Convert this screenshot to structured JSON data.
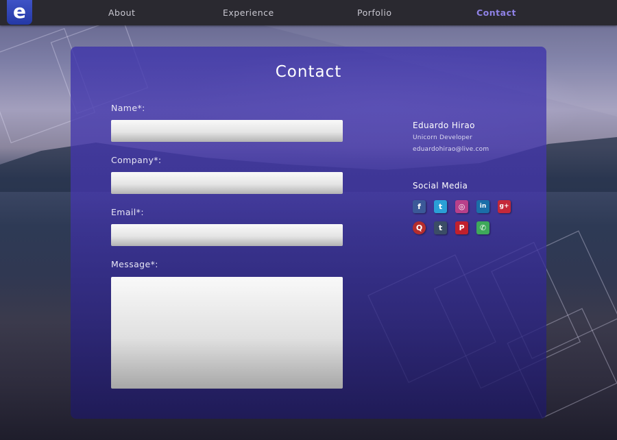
{
  "nav": {
    "logo_letter": "e",
    "items": [
      {
        "label": "About",
        "active": false
      },
      {
        "label": "Experience",
        "active": false
      },
      {
        "label": "Porfolio",
        "active": false
      },
      {
        "label": "Contact",
        "active": true
      }
    ]
  },
  "contact": {
    "title": "Contact",
    "fields": {
      "name": {
        "label": "Name*:",
        "value": "",
        "placeholder": ""
      },
      "company": {
        "label": "Company*:",
        "value": "",
        "placeholder": ""
      },
      "email": {
        "label": "Email*:",
        "value": "",
        "placeholder": ""
      },
      "message": {
        "label": "Message*:",
        "value": "",
        "placeholder": ""
      }
    }
  },
  "profile": {
    "name": "Eduardo Hirao",
    "role": "Unicorn Developer",
    "email": "eduardohirao@live.com"
  },
  "social": {
    "title": "Social Media",
    "icons": [
      {
        "name": "facebook-icon",
        "glyph": "f",
        "color": "#3b5998"
      },
      {
        "name": "twitter-icon",
        "glyph": "t",
        "color": "#2a9fd6"
      },
      {
        "name": "instagram-icon",
        "glyph": "◎",
        "color": "#b8408a"
      },
      {
        "name": "linkedin-icon",
        "glyph": "in",
        "color": "#1b6ea8"
      },
      {
        "name": "google-plus-icon",
        "glyph": "g+",
        "color": "#c4283a"
      },
      {
        "name": "quora-icon",
        "glyph": "Q",
        "color": "#b52d2d"
      },
      {
        "name": "tumblr-icon",
        "glyph": "t",
        "color": "#3b4d66"
      },
      {
        "name": "pinterest-icon",
        "glyph": "P",
        "color": "#c1202d"
      },
      {
        "name": "whatsapp-icon",
        "glyph": "✆",
        "color": "#3ea85a"
      }
    ]
  },
  "colors": {
    "nav_bg": "#2a2930",
    "nav_active": "#8f82e6",
    "card_bg": "#3c32aa",
    "logo_bg": "#2f43b6"
  }
}
